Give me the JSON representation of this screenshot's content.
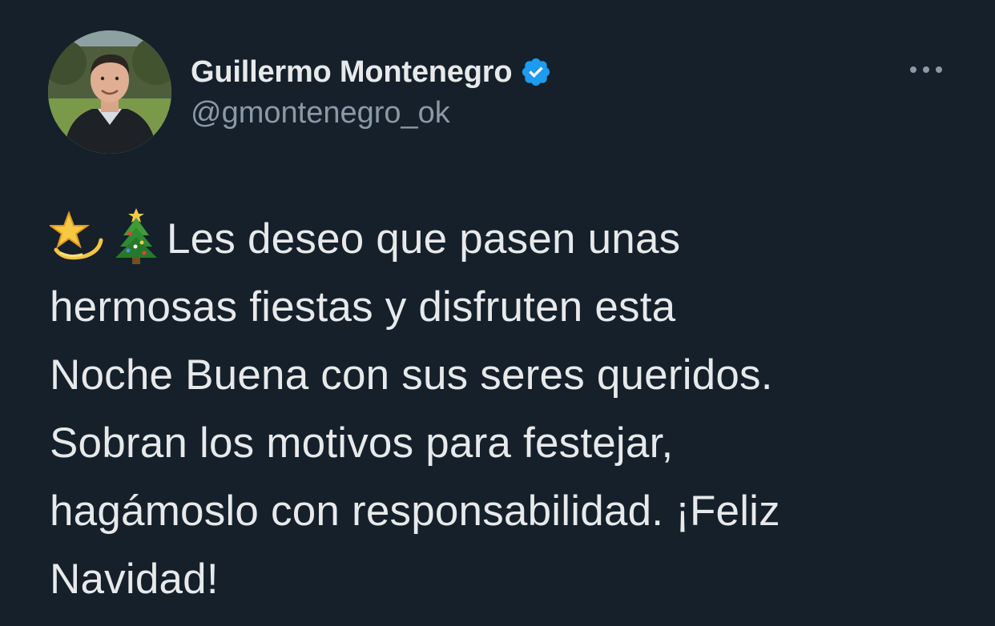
{
  "user": {
    "display_name": "Guillermo Montenegro",
    "handle": "@gmontenegro_ok",
    "verified": true
  },
  "tweet": {
    "emojis": [
      "dizzy-star-emoji",
      "christmas-tree-emoji"
    ],
    "lines": [
      "Les deseo que pasen unas",
      "hermosas fiestas y disfruten esta",
      "Noche Buena con sus seres queridos.",
      "Sobran los motivos para festejar,",
      "hagámoslo con responsabilidad. ¡Feliz",
      "Navidad!"
    ]
  },
  "icons": {
    "verified": "verified-badge-icon",
    "more": "more-options-icon"
  },
  "colors": {
    "background": "#15202b",
    "text_primary": "#e7e9ea",
    "text_secondary": "#8b98a5",
    "verified_blue": "#1d9bf0"
  }
}
